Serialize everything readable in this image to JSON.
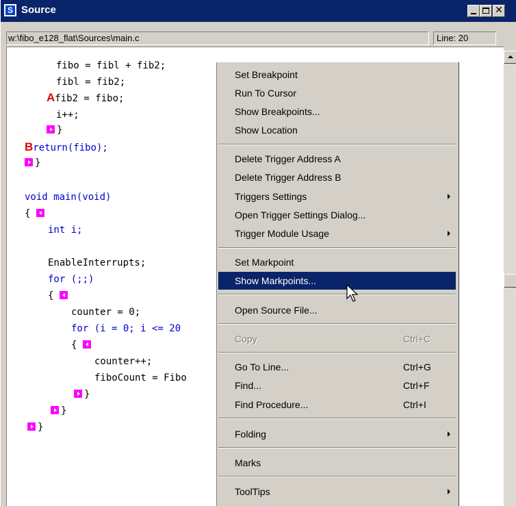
{
  "window": {
    "title": "Source"
  },
  "pathbar": {
    "path": "w:\\fibo_e128_flat\\Sources\\main.c",
    "line": "Line: 20"
  },
  "code": [
    "fibo = fibl + fib2;",
    "fibl = fib2;",
    "fib2 = fibo;",
    "i++;",
    "}",
    "return(fibo);",
    "}",
    "void main(void)",
    "{",
    "int i;",
    "EnableInterrupts;",
    "for (;;)",
    "{",
    "counter = 0;",
    "for (i = 0; i <= 20",
    "{",
    "counter++;",
    "fiboCount = Fibo",
    "}",
    "}",
    "}"
  ],
  "markers": {
    "a": "A",
    "b": "B"
  },
  "menu": {
    "set_breakpoint": "Set Breakpoint",
    "run_to_cursor": "Run To Cursor",
    "show_breakpoints": "Show Breakpoints...",
    "show_location": "Show Location",
    "delete_trigger_a": "Delete Trigger Address A",
    "delete_trigger_b": "Delete Trigger Address B",
    "triggers_settings": "Triggers Settings",
    "open_trigger_dialog": "Open Trigger Settings Dialog...",
    "trigger_module_usage": "Trigger Module Usage",
    "set_markpoint": "Set Markpoint",
    "show_markpoints": "Show Markpoints...",
    "open_source_file": "Open Source File...",
    "copy": "Copy",
    "copy_sc": "Ctrl+C",
    "go_to_line": "Go To Line...",
    "go_to_line_sc": "Ctrl+G",
    "find": "Find...",
    "find_sc": "Ctrl+F",
    "find_procedure": "Find Procedure...",
    "find_procedure_sc": "Ctrl+I",
    "folding": "Folding",
    "marks": "Marks",
    "tooltips": "ToolTips"
  },
  "colors": {
    "titlebar": "#0a246a",
    "highlight": "#0a246a",
    "keyword": "#0000cc",
    "marker": "#e00000",
    "fold": "#ff00ff"
  }
}
